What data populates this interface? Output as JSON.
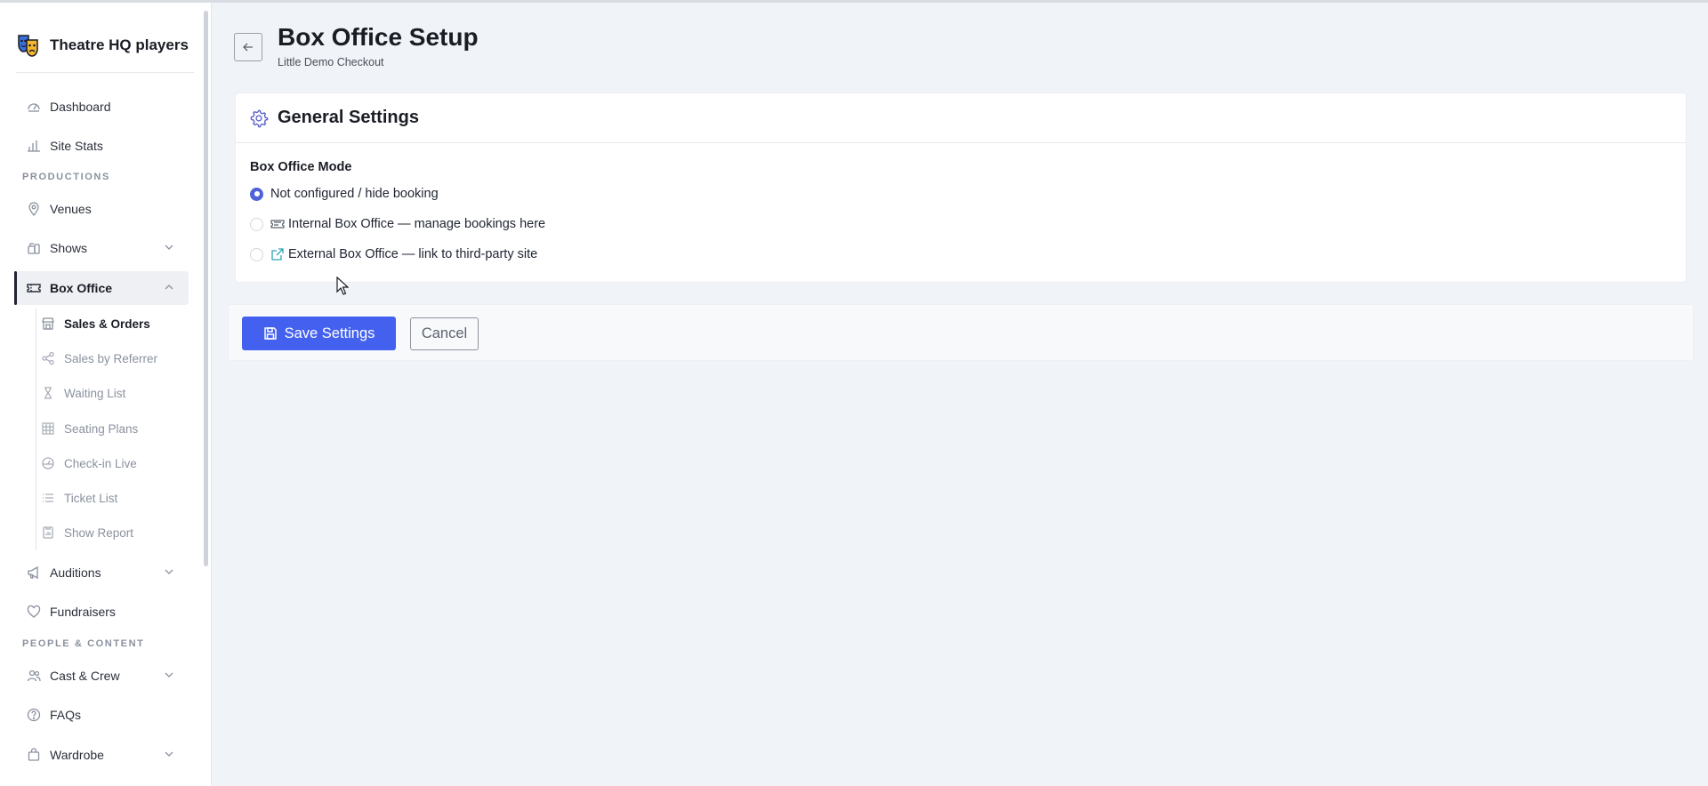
{
  "brand": {
    "name": "Theatre HQ players"
  },
  "sidebar": {
    "items_top": [
      {
        "label": "Dashboard",
        "icon": "dashboard-icon"
      },
      {
        "label": "Site Stats",
        "icon": "bar-chart-icon"
      }
    ],
    "section_productions": "PRODUCTIONS",
    "productions": [
      {
        "label": "Venues",
        "icon": "map-pin-icon"
      },
      {
        "label": "Shows",
        "icon": "people-icon"
      },
      {
        "label": "Box Office",
        "icon": "ticket-icon"
      }
    ],
    "box_office_sub": [
      {
        "label": "Sales & Orders",
        "icon": "store-icon"
      },
      {
        "label": "Sales by Referrer",
        "icon": "share-icon"
      },
      {
        "label": "Waiting List",
        "icon": "hourglass-icon"
      },
      {
        "label": "Seating Plans",
        "icon": "grid-icon"
      },
      {
        "label": "Check-in Live",
        "icon": "gauge-icon"
      },
      {
        "label": "Ticket List",
        "icon": "list-icon"
      },
      {
        "label": "Show Report",
        "icon": "report-icon"
      }
    ],
    "productions_more": [
      {
        "label": "Auditions",
        "icon": "megaphone-icon"
      },
      {
        "label": "Fundraisers",
        "icon": "heart-icon"
      }
    ],
    "section_people": "PEOPLE & CONTENT",
    "people": [
      {
        "label": "Cast & Crew",
        "icon": "people-icon"
      },
      {
        "label": "FAQs",
        "icon": "question-icon"
      },
      {
        "label": "Wardrobe",
        "icon": "bag-icon"
      }
    ]
  },
  "header": {
    "title": "Box Office Setup",
    "subtitle": "Little Demo Checkout"
  },
  "card": {
    "title": "General Settings",
    "field_label": "Box Office Mode",
    "options": [
      {
        "label": "Not configured / hide booking",
        "checked": true
      },
      {
        "label": "Internal Box Office — manage bookings here",
        "checked": false
      },
      {
        "label": "External Box Office — link to third-party site",
        "checked": false
      }
    ]
  },
  "actions": {
    "save_label": "Save Settings",
    "cancel_label": "Cancel"
  },
  "colors": {
    "accent": "#4361ee",
    "radio": "#4f63d8",
    "gear": "#5b63c7"
  }
}
